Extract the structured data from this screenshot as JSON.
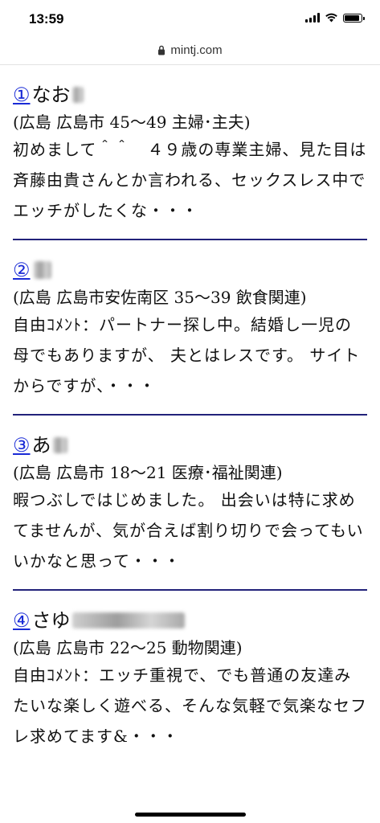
{
  "status_bar": {
    "time": "13:59",
    "icons": [
      "signal-icon",
      "wifi-icon",
      "battery-icon"
    ],
    "battery_level": 0.9
  },
  "address_bar": {
    "url": "mintj.com",
    "icon": "lock-icon"
  },
  "entries": [
    {
      "number": "①",
      "name": "なお",
      "meta": "(広島 広島市 45〜49 主婦･主夫)",
      "body": "初めまして＾＾　４９歳の専業主婦、見た目は斉藤由貴さんとか言われる、セックスレス中でエッチがしたくな・・・"
    },
    {
      "number": "②",
      "name": "",
      "meta": "(広島 広島市安佐南区 35〜39 飲食関連)",
      "body": "自由ｺﾒﾝﾄ：パートナー探し中。結婚し一児の母でもありますが、 夫とはレスです。 サイトからですが、・・・"
    },
    {
      "number": "③",
      "name": "あ",
      "meta": "(広島 広島市 18〜21 医療･福祉関連)",
      "body": "暇つぶしではじめました。 出会いは特に求めてませんが、気が合えば割り切りで会ってもいいかなと思って・・・"
    },
    {
      "number": "④",
      "name": "さゆ",
      "meta": "(広島 広島市 22〜25 動物関連)",
      "body": "自由ｺﾒﾝﾄ：エッチ重視で、でも普通の友達みたいな楽しく遊べる、そんな気軽で気楽なセフレ求めてます&・・・"
    }
  ]
}
